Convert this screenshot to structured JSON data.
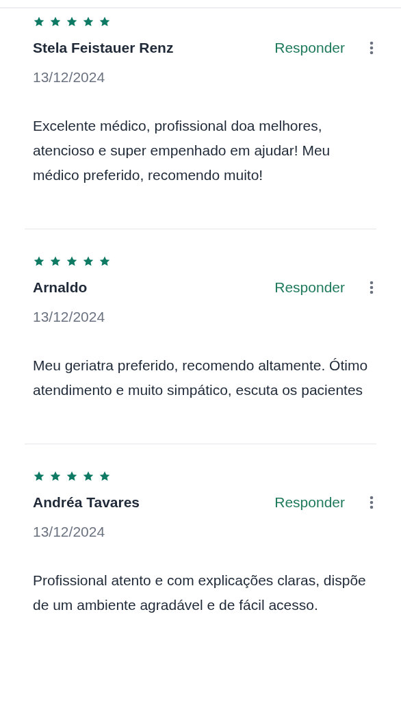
{
  "reviews": [
    {
      "stars": 5,
      "name": "Stela Feistauer Renz",
      "reply": "Responder",
      "date": "13/12/2024",
      "text": "Excelente médico, profissional doa melhores, atencioso e super empenhado em ajudar! Meu médico preferido, recomendo muito!"
    },
    {
      "stars": 5,
      "name": "Arnaldo",
      "reply": "Responder",
      "date": "13/12/2024",
      "text": "Meu geriatra preferido, recomendo altamente. Ótimo atendimento e muito simpático, escuta os pacientes"
    },
    {
      "stars": 5,
      "name": "Andréa Tavares",
      "reply": "Responder",
      "date": "13/12/2024",
      "text": "Profissional atento e com explicações claras, dispõe de um ambiente agradável e de fácil acesso."
    }
  ]
}
